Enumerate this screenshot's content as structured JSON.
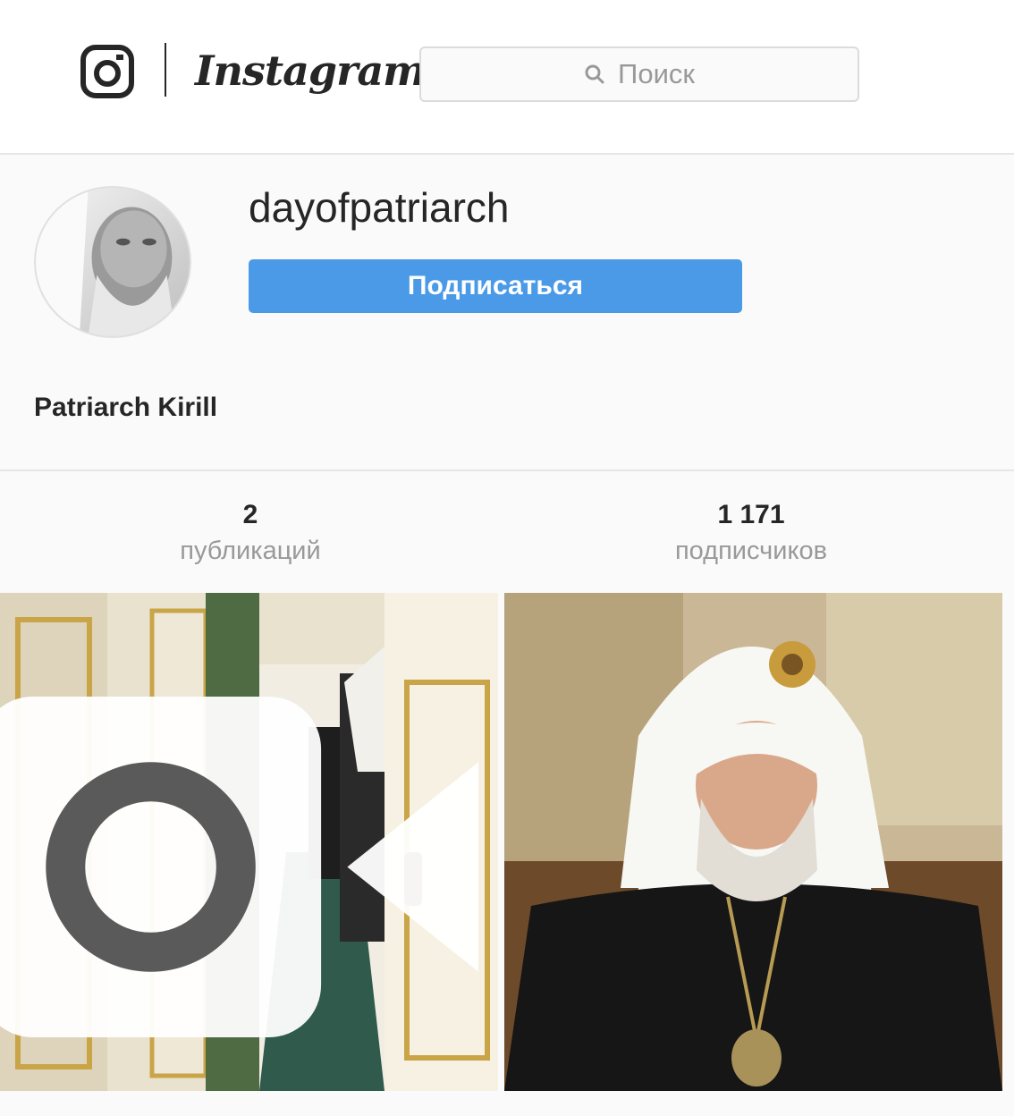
{
  "header": {
    "wordmark": "Instagram",
    "search": {
      "placeholder": "Поиск",
      "icon": "search-icon"
    },
    "logo_icon": "instagram-camera-icon"
  },
  "profile": {
    "username": "dayofpatriarch",
    "follow_label": "Подписаться",
    "full_name": "Patriarch Kirill",
    "avatar_alt": "profile-avatar"
  },
  "stats": {
    "posts": {
      "count": "2",
      "label": "публикаций"
    },
    "followers": {
      "count": "1 171",
      "label": "подписчиков"
    }
  },
  "posts": [
    {
      "type": "video",
      "badge_icon": "video-camera-icon"
    },
    {
      "type": "image"
    }
  ],
  "colors": {
    "accent": "#4a9ae8",
    "background": "#fafafa",
    "text": "#262626",
    "muted": "#999999"
  }
}
